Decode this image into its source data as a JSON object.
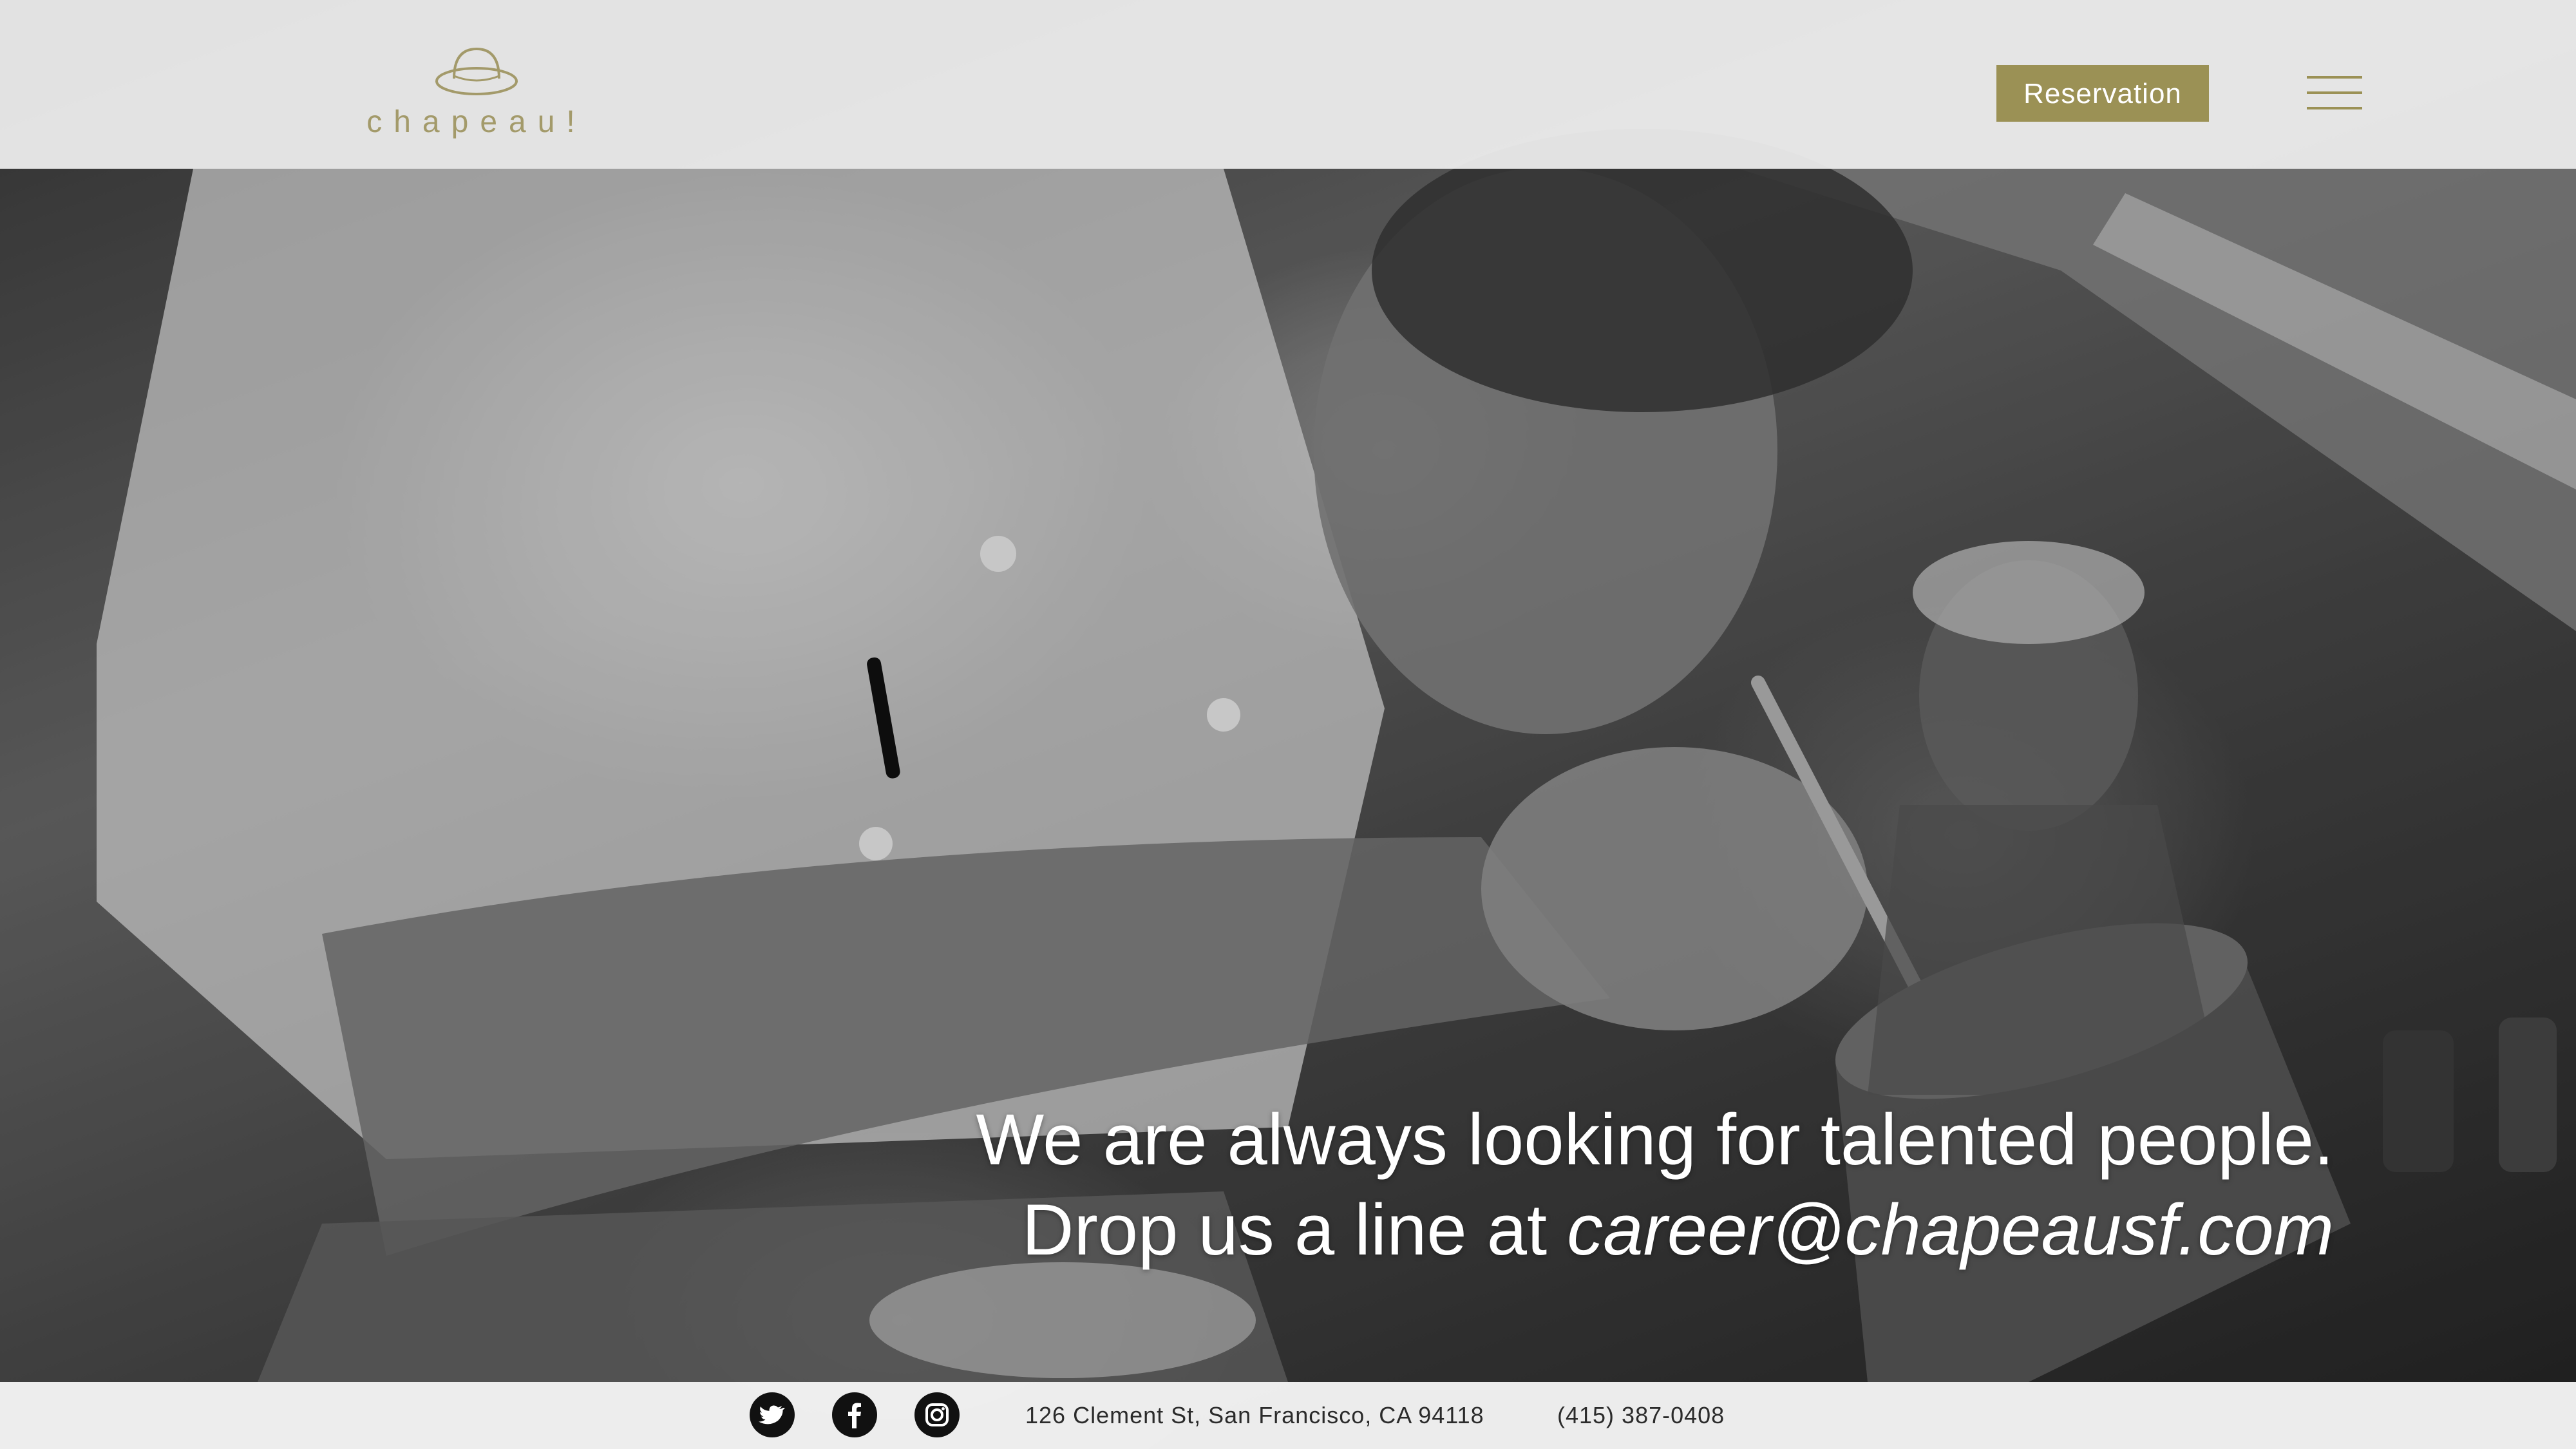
{
  "brand": {
    "name": "chapeau!",
    "accent_color": "#9b9155"
  },
  "header": {
    "reservation_label": "Reservation",
    "menu_icon": "hamburger-menu-icon"
  },
  "hero": {
    "line1": "We are always looking for talented people.",
    "line2_prefix": "Drop us a line at ",
    "email": "career@chapeausf.com"
  },
  "footer": {
    "social": [
      {
        "name": "twitter",
        "icon": "twitter-icon"
      },
      {
        "name": "facebook",
        "icon": "facebook-icon"
      },
      {
        "name": "instagram",
        "icon": "instagram-icon"
      }
    ],
    "address": "126 Clement St, San Francisco, CA 94118",
    "phone": "(415) 387-0408"
  }
}
